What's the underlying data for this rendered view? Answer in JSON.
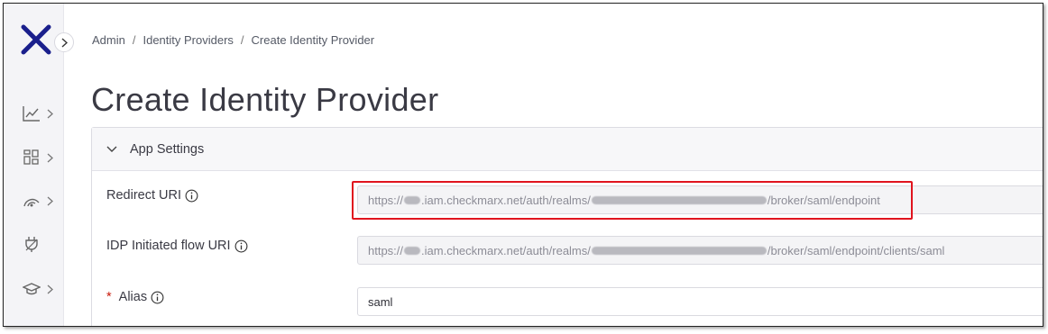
{
  "sidebar": {
    "logo_icon": "close-x-logo",
    "expand_icon": "chevron-right-icon",
    "items": [
      {
        "icon": "chart-line-icon"
      },
      {
        "icon": "dashboard-grid-icon"
      },
      {
        "icon": "radar-icon"
      },
      {
        "icon": "plug-icon"
      },
      {
        "icon": "graduation-cap-icon"
      }
    ]
  },
  "breadcrumb": {
    "items": [
      "Admin",
      "Identity Providers",
      "Create Identity Provider"
    ],
    "separator": "/"
  },
  "page_title": "Create Identity Provider",
  "panel": {
    "header_label": "App Settings",
    "fields": {
      "redirect_uri": {
        "label": "Redirect URI",
        "value_prefix": "https://",
        "value_mid": ".iam.checkmarx.net/auth/realms/",
        "value_suffix": "/broker/saml/endpoint"
      },
      "idp_initiated": {
        "label": "IDP Initiated flow URI",
        "value_prefix": "https://",
        "value_mid": ".iam.checkmarx.net/auth/realms/",
        "value_suffix": "/broker/saml/endpoint/clients/saml"
      },
      "alias": {
        "label": "Alias",
        "required_marker": "*",
        "value": "saml"
      }
    }
  },
  "colors": {
    "brand_logo": "#1a1f8c",
    "highlight": "#e0141e",
    "required": "#c9190b"
  }
}
